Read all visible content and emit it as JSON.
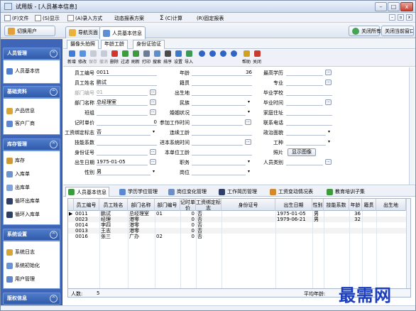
{
  "window": {
    "title": "试用版 - [人员基本信息]",
    "min": "–",
    "max": "□",
    "close": "x"
  },
  "menu": {
    "items": [
      "(F)文件",
      "(S)显示",
      "(A)录入方式",
      "动态报表方案",
      "(C)计算",
      "(R)固定报表"
    ],
    "mdi": [
      "–",
      "▫",
      "x"
    ]
  },
  "tabbar": {
    "switch_user": "切换用户",
    "tabs": [
      "导航页面",
      "人员基本信息"
    ],
    "close_all": "关闭所有",
    "close_current": "关闭当前窗口"
  },
  "sidebar": {
    "sections": [
      {
        "title": "人员管理",
        "items": [
          "人员基本信"
        ]
      },
      {
        "title": "基础资料",
        "items": [
          "产品信息",
          "客户厂商"
        ]
      },
      {
        "title": "库存管理",
        "items": [
          "库存",
          "入库单",
          "出库单",
          "循环出库单",
          "循环入库单"
        ]
      },
      {
        "title": "系统设置",
        "items": [
          "系统日志",
          "系统初始化",
          "用户管理"
        ]
      },
      {
        "title": "版权信息",
        "items": []
      }
    ],
    "chevron": "^"
  },
  "subtabs": [
    "摄像头拍照",
    "年龄工龄",
    "身份证验证"
  ],
  "toolbar": [
    "新增",
    "修改",
    "保存",
    "撤消",
    "删除",
    "过滤",
    "刷新",
    "打印",
    "搜索",
    "排序",
    "设置",
    "导入",
    "",
    "",
    "",
    "",
    "帮助",
    "关闭"
  ],
  "form": {
    "employee_no": {
      "label": "员工编号",
      "value": "0011"
    },
    "employee_name": {
      "label": "员工姓名",
      "value": "鹏试"
    },
    "dept_no": {
      "label": "部门编号",
      "value": "01"
    },
    "dept_name": {
      "label": "部门名称",
      "value": "总经理室"
    },
    "team": {
      "label": "班组",
      "value": ""
    },
    "hourly_price": {
      "label": "记时单价",
      "value": "0"
    },
    "salary_standard": {
      "label": "工资绑定标志",
      "value": "否"
    },
    "skill": {
      "label": "技能系数",
      "value": ""
    },
    "id_card": {
      "label": "身份证号",
      "value": ""
    },
    "birth": {
      "label": "出生日期",
      "value": "1975-01-05"
    },
    "gender": {
      "label": "性别",
      "value": "男"
    },
    "age": {
      "label": "年龄",
      "value": "36"
    },
    "native": {
      "label": "籍贯",
      "value": ""
    },
    "birthplace": {
      "label": "出生地",
      "value": ""
    },
    "ethnic": {
      "label": "民族",
      "value": ""
    },
    "marital": {
      "label": "婚姻状况",
      "value": ""
    },
    "work_date": {
      "label": "参加工作时间",
      "value": ""
    },
    "seniority": {
      "label": "连续工龄",
      "value": ""
    },
    "factory_date": {
      "label": "进本系统时间",
      "value": ""
    },
    "unit_seniority": {
      "label": "本单位工龄",
      "value": ""
    },
    "position": {
      "label": "职务",
      "value": ""
    },
    "title": {
      "label": "岗位",
      "value": ""
    },
    "education": {
      "label": "最高学历",
      "value": ""
    },
    "major": {
      "label": "专业",
      "value": ""
    },
    "school": {
      "label": "毕业学校",
      "value": ""
    },
    "grad_time": {
      "label": "毕业时间",
      "value": ""
    },
    "address": {
      "label": "家庭住址",
      "value": ""
    },
    "phone": {
      "label": "联系电话",
      "value": ""
    },
    "political": {
      "label": "政治面貌",
      "value": ""
    },
    "work_type": {
      "label": "工种",
      "value": ""
    },
    "photo": {
      "label": "照片",
      "value": ""
    },
    "show_image": "显示图像",
    "person_type": {
      "label": "人员类别",
      "value": ""
    }
  },
  "lower_tabs": [
    "人员基本信息",
    "学历学位管理",
    "岗位变化管理",
    "工作简历管理",
    "工资变动情况表",
    "教育培训子集"
  ],
  "grid": {
    "columns": [
      "员工编号",
      "员工姓名",
      "部门名称",
      "部门编号",
      "记时单价",
      "工资绑定标志",
      "身份证号",
      "出生日期",
      "性别",
      "技能系数",
      "年龄",
      "籍贯",
      "出生地"
    ],
    "rows": [
      {
        "marker": "▶",
        "cells": [
          "0011",
          "鹏试",
          "总经理室",
          "01",
          "0",
          "否",
          "",
          "1975-01-05",
          "男",
          "",
          "36",
          "",
          ""
        ]
      },
      {
        "marker": "",
        "cells": [
          "0023",
          "经理",
          "港零",
          "",
          "0",
          "否",
          "",
          "1979-06-21",
          "男",
          "",
          "32",
          "",
          ""
        ]
      },
      {
        "marker": "",
        "cells": [
          "0014",
          "李四",
          "港零",
          "",
          "0",
          "否",
          "",
          "",
          "",
          "",
          "",
          "",
          ""
        ]
      },
      {
        "marker": "",
        "cells": [
          "0013",
          "王志",
          "港零",
          "",
          "0",
          "否",
          "",
          "",
          "",
          "",
          "",
          "",
          ""
        ]
      },
      {
        "marker": "",
        "cells": [
          "0016",
          "张三",
          "广办",
          "02",
          "0",
          "否",
          "",
          "",
          "",
          "",
          "",
          "",
          ""
        ]
      }
    ],
    "footer_count_label": "人数:",
    "footer_count": "5",
    "footer_avg_label": "平均年龄:"
  },
  "watermark": "最需网",
  "colors": {
    "sidebar_bg": "#3e65b7",
    "accent": "#2f5aa9",
    "watermark": "#1a3dbf"
  }
}
